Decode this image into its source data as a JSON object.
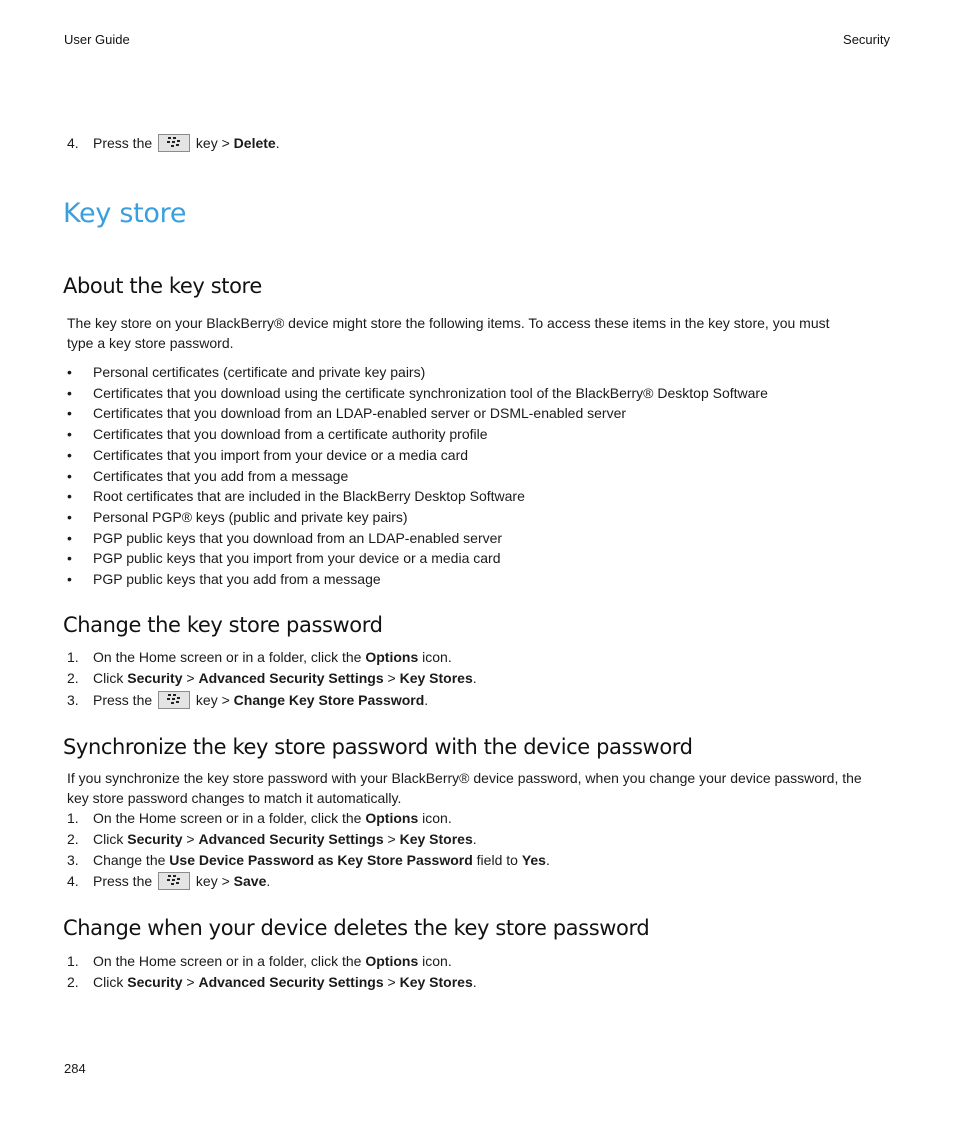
{
  "header": {
    "left": "User Guide",
    "right": "Security"
  },
  "top_step": {
    "number": "4.",
    "pre": "Press the",
    "mid": "key >",
    "bold": "Delete",
    "end": "."
  },
  "menu_key_icon": "blackberry-menu-key-icon",
  "title": "Key store",
  "sections": {
    "about": {
      "heading": "About the key store",
      "intro_line1": "The key store on your BlackBerry® device might store the following items. To access these items in the key store, you must",
      "intro_line2": "type a key store password.",
      "bullets": [
        "Personal certificates (certificate and private key pairs)",
        "Certificates that you download using the certificate synchronization tool of the BlackBerry® Desktop Software",
        "Certificates that you download from an LDAP-enabled server or DSML-enabled server",
        "Certificates that you download from a certificate authority profile",
        "Certificates that you import from your device or a media card",
        "Certificates that you add from a message",
        "Root certificates that are included in the BlackBerry Desktop Software",
        "Personal PGP® keys (public and private key pairs)",
        "PGP public keys that you download from an LDAP-enabled server",
        "PGP public keys that you import from your device or a media card",
        "PGP public keys that you add from a message"
      ]
    },
    "change": {
      "heading": "Change the key store password",
      "steps": [
        {
          "num": "1.",
          "a": "On the Home screen or in a folder, click the ",
          "b1": "Options",
          "c": " icon."
        },
        {
          "num": "2.",
          "a": "Click ",
          "b1": "Security",
          "sep1": " > ",
          "b2": "Advanced Security Settings",
          "sep2": " > ",
          "b3": "Key Stores",
          "end": "."
        },
        {
          "num": "3.",
          "pre": "Press the",
          "mid": "key >",
          "bold": "Change Key Store Password",
          "end": "."
        }
      ]
    },
    "sync": {
      "heading": "Synchronize the key store password with the device password",
      "intro_line1": "If you synchronize the key store password with your BlackBerry® device password, when you change your device password, the",
      "intro_line2": "key store password changes to match it automatically.",
      "steps": [
        {
          "num": "1.",
          "a": "On the Home screen or in a folder, click the ",
          "b1": "Options",
          "c": " icon."
        },
        {
          "num": "2.",
          "a": "Click ",
          "b1": "Security",
          "sep1": " > ",
          "b2": "Advanced Security Settings",
          "sep2": " > ",
          "b3": "Key Stores",
          "end": "."
        },
        {
          "num": "3.",
          "a": "Change the ",
          "b1": "Use Device Password as Key Store Password",
          "c": " field to ",
          "b2": "Yes",
          "end": "."
        },
        {
          "num": "4.",
          "pre": "Press the",
          "mid": "key >",
          "bold": "Save",
          "end": "."
        }
      ]
    },
    "delete": {
      "heading": "Change when your device deletes the key store password",
      "steps": [
        {
          "num": "1.",
          "a": "On the Home screen or in a folder, click the ",
          "b1": "Options",
          "c": " icon."
        },
        {
          "num": "2.",
          "a": "Click ",
          "b1": "Security",
          "sep1": " > ",
          "b2": "Advanced Security Settings",
          "sep2": " > ",
          "b3": "Key Stores",
          "end": "."
        }
      ]
    }
  },
  "footer": {
    "page_number": "284"
  }
}
